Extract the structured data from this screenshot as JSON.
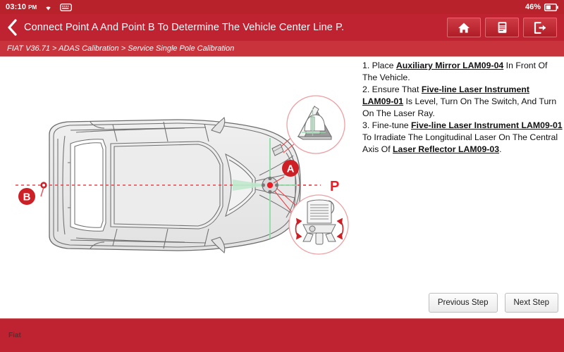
{
  "statusbar": {
    "time": "03:10",
    "ampm": "PM",
    "wifi_icon": "wifi-icon",
    "keyboard_icon": "keyboard-icon",
    "battery_text": "46%",
    "battery_icon": "battery-icon"
  },
  "header": {
    "back_icon": "chevron-left-icon",
    "title": "Connect Point A And Point B To Determine The Vehicle Center Line P.",
    "buttons": [
      {
        "name": "home-button",
        "icon": "home-icon"
      },
      {
        "name": "report-button",
        "icon": "report-icon"
      },
      {
        "name": "exit-button",
        "icon": "exit-icon"
      }
    ],
    "bg_color": "#bf2230"
  },
  "breadcrumb": {
    "text": "FIAT V36.71 > ADAS Calibration > Service Single Pole Calibration"
  },
  "instructions": {
    "step1_pre": "1. Place ",
    "step1_part": "Auxiliary Mirror LAM09-04",
    "step1_post": " In Front Of The Vehicle.",
    "step2_pre": "2. Ensure That ",
    "step2_part": "Five-line Laser Instrument LAM09-01",
    "step2_post": " Is Level, Turn On The Switch, And Turn On The Laser Ray.",
    "step3_pre": "3. Fine-tune ",
    "step3_part": "Five-line Laser Instrument LAM09-01",
    "step3_mid": " To Irradiate The Longitudinal Laser On The Central Axis Of ",
    "step3_part2": "Laser Reflector LAM09-03",
    "step3_post": "."
  },
  "diagram": {
    "label_a": "A",
    "label_b": "B",
    "label_p": "P",
    "callout_top_name": "auxiliary-mirror-callout",
    "callout_bottom_name": "laser-instrument-callout",
    "center_line_color": "#e8444a",
    "laser_line_color": "#8ddba6",
    "marker_color": "#cc2026",
    "car_fill": "#e8e8e8",
    "car_stroke": "#7a7a7a"
  },
  "footer": {
    "buttons": {
      "previous": "Previous Step",
      "next": "Next Step"
    },
    "label": "Fiat"
  }
}
